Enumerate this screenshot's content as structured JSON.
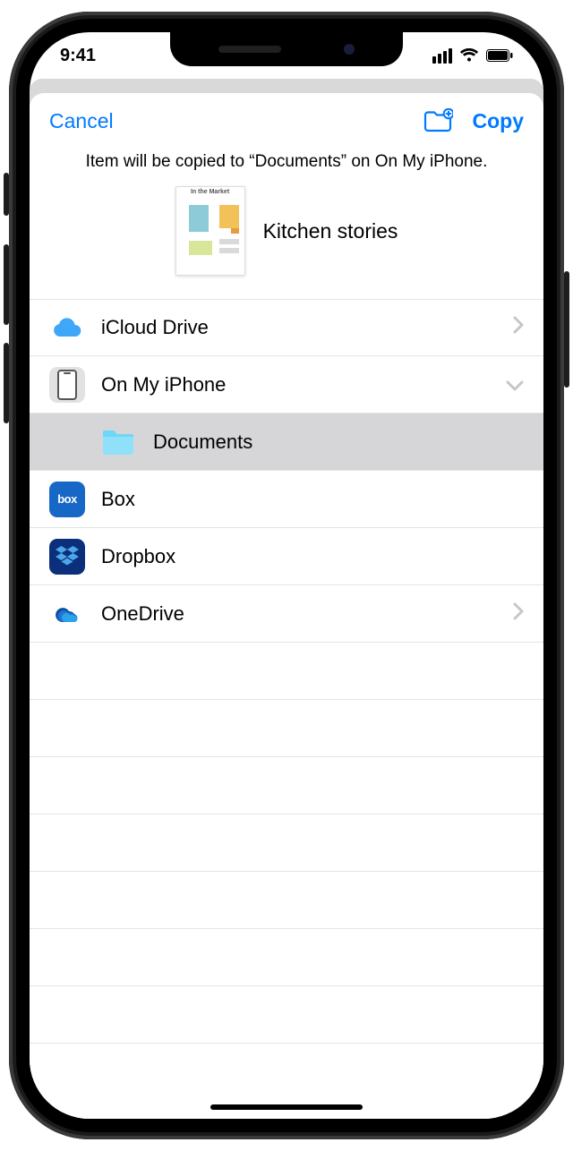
{
  "status": {
    "time": "9:41"
  },
  "nav": {
    "cancel": "Cancel",
    "copy": "Copy"
  },
  "prompt": "Item will be copied to “Documents” on On My iPhone.",
  "item": {
    "name": "Kitchen stories",
    "thumb_caption": "In the Market"
  },
  "locations": {
    "icloud": "iCloud Drive",
    "on_my_iphone": "On My iPhone",
    "documents": "Documents",
    "box": "Box",
    "dropbox": "Dropbox",
    "onedrive": "OneDrive"
  },
  "icons": {
    "box_label": "box"
  }
}
